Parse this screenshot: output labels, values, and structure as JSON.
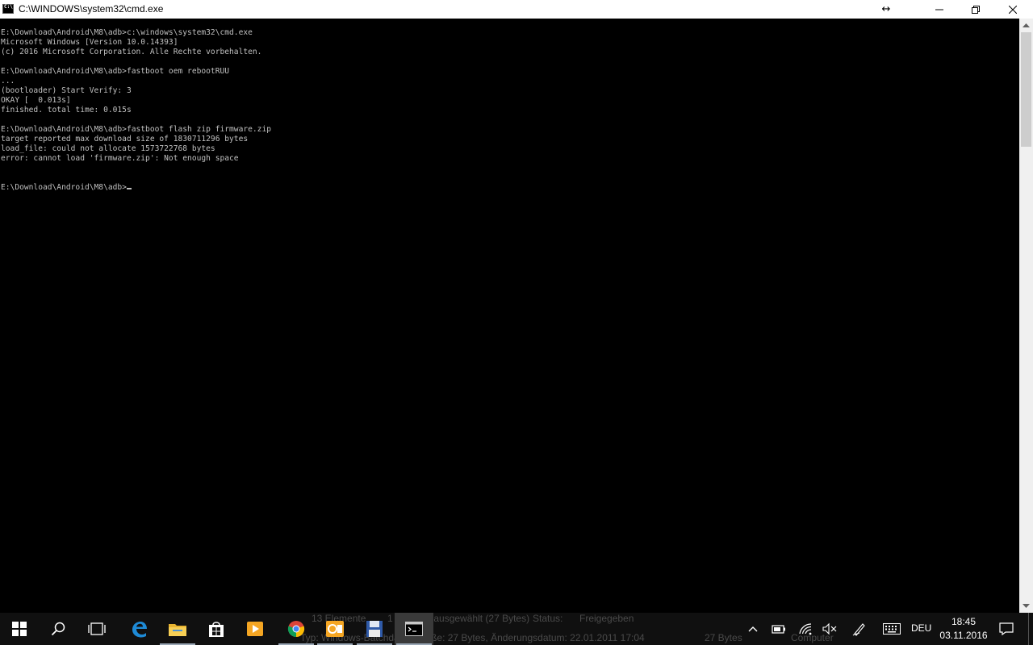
{
  "window": {
    "title": "C:\\WINDOWS\\system32\\cmd.exe",
    "controls": {
      "resize": "↔",
      "minimize": "—",
      "maximize": "❐",
      "close": "✕"
    }
  },
  "console": {
    "lines": [
      "E:\\Download\\Android\\M8\\adb>c:\\windows\\system32\\cmd.exe",
      "Microsoft Windows [Version 10.0.14393]",
      "(c) 2016 Microsoft Corporation. Alle Rechte vorbehalten.",
      "",
      "E:\\Download\\Android\\M8\\adb>fastboot oem rebootRUU",
      "...",
      "(bootloader) Start Verify: 3",
      "OKAY [  0.013s]",
      "finished. total time: 0.015s",
      "",
      "E:\\Download\\Android\\M8\\adb>fastboot flash zip firmware.zip",
      "target reported max download size of 1830711296 bytes",
      "load_file: could not allocate 1573722768 bytes",
      "error: cannot load 'firmware.zip': Not enough space",
      "",
      "",
      "E:\\Download\\Android\\M8\\adb>"
    ],
    "text_color": "#c0c0c0",
    "background": "#000000"
  },
  "taskbar": {
    "apps": [
      {
        "name": "start",
        "icon": "windows-start-icon"
      },
      {
        "name": "search",
        "icon": "search-icon"
      },
      {
        "name": "task-view",
        "icon": "task-view-icon"
      },
      {
        "name": "edge",
        "icon": "edge-icon"
      },
      {
        "name": "file-explorer",
        "icon": "folder-icon"
      },
      {
        "name": "store",
        "icon": "store-icon"
      },
      {
        "name": "media-player",
        "icon": "media-player-icon"
      },
      {
        "name": "chrome",
        "icon": "chrome-icon"
      },
      {
        "name": "outlook",
        "icon": "outlook-icon"
      },
      {
        "name": "save",
        "icon": "floppy-icon"
      },
      {
        "name": "cmd",
        "icon": "cmd-icon"
      }
    ],
    "ghost_text": {
      "items": "13 Elemente",
      "selected": "1 Element ausgewählt (27 Bytes)",
      "status": "Status:",
      "shared": "Freigegeben",
      "type": "Typ: Windows-Batchdatei, Größe: 27 Bytes, Änderungsdatum: 22.01.2011 17:04",
      "size": "27 Bytes",
      "computer": "Computer"
    },
    "tray": {
      "language": "DEU",
      "time": "18:45",
      "date": "03.11.2016"
    }
  }
}
